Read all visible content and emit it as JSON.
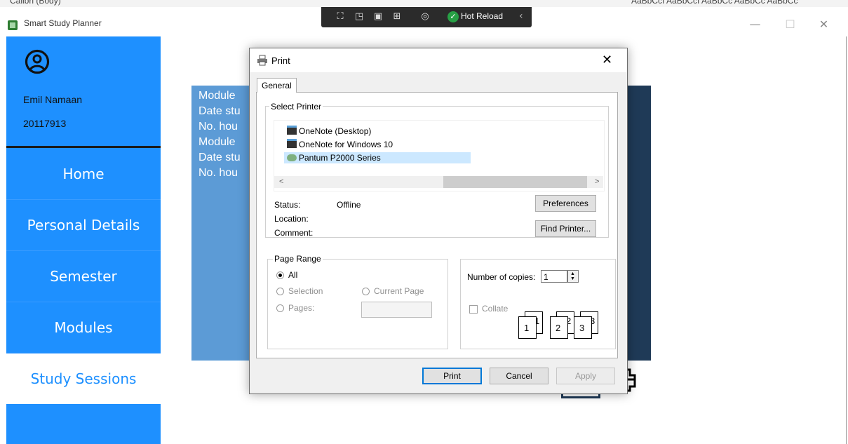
{
  "app": {
    "title": "Smart Study Planner",
    "window_controls": [
      "—",
      "☐",
      "✕"
    ]
  },
  "background_strip": {
    "left_text": "Calibri (Body)",
    "right_text": "AaBbCcI AaBbCcI AaBbCc AaBbCc AaBbCc"
  },
  "xaml_toolbar": {
    "icons": [
      "select-element-icon",
      "display-adorners-icon",
      "track-focus-icon",
      "layout-adorners-icon",
      "accessibility-icon"
    ],
    "hot_reload_label": "Hot Reload"
  },
  "sidebar": {
    "user_name": "Emil Namaan",
    "user_id": "20117913",
    "items": [
      {
        "label": "Home",
        "active": false
      },
      {
        "label": "Personal Details",
        "active": false
      },
      {
        "label": "Semester",
        "active": false
      },
      {
        "label": "Modules",
        "active": false
      },
      {
        "label": "Study Sessions",
        "active": true
      }
    ],
    "colors": {
      "bg": "#1e90ff",
      "active_bg": "#ffffff",
      "active_text": "#1e90ff"
    }
  },
  "content_panel": {
    "lines": [
      "Module",
      "Date stu",
      "No. hou",
      "Module",
      "Date stu",
      "No. hou"
    ]
  },
  "print_dialog": {
    "title": "Print",
    "tab": "General",
    "select_printer": {
      "legend": "Select Printer",
      "printers": [
        {
          "name": "OneNote (Desktop)",
          "selected": false
        },
        {
          "name": "OneNote for Windows 10",
          "selected": false
        },
        {
          "name": "Pantum P2000 Series",
          "selected": true
        }
      ],
      "status_label": "Status:",
      "status_value": "Offline",
      "location_label": "Location:",
      "comment_label": "Comment:",
      "preferences_button": "Preferences",
      "find_printer_button": "Find Printer..."
    },
    "page_range": {
      "legend": "Page Range",
      "all_label": "All",
      "selection_label": "Selection",
      "current_page_label": "Current Page",
      "pages_label": "Pages:"
    },
    "copies": {
      "label": "Number of copies:",
      "value": "1",
      "collate_label": "Collate",
      "collate_numbers": [
        "1",
        "1",
        "2",
        "2",
        "3",
        "3"
      ]
    },
    "buttons": {
      "print": "Print",
      "cancel": "Cancel",
      "apply": "Apply"
    }
  }
}
